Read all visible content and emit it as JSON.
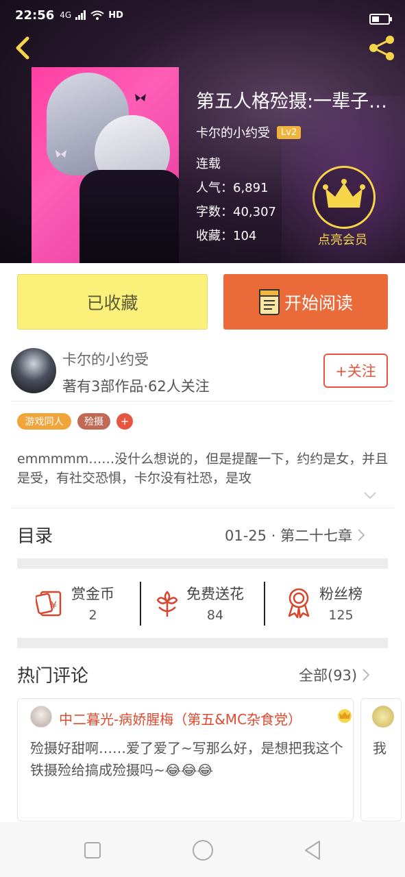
{
  "status_bar": {
    "time": "22:56",
    "network": "4G",
    "hd": "HD"
  },
  "book": {
    "title": "第五人格殓摄:一辈子…",
    "author": "卡尔的小约受",
    "level": "Lv2",
    "status": "连载",
    "popularity": "人气：6,891",
    "word_count": "字数：40,307",
    "favorites": "收藏：104",
    "vip_label": "点亮会员"
  },
  "actions": {
    "collect_label": "已收藏",
    "read_label": "开始阅读"
  },
  "author_row": {
    "name": "卡尔的小约受",
    "stats": "著有3部作品·62人关注",
    "follow_label": "+关注"
  },
  "tags": [
    {
      "label": "游戏同人",
      "color": "#f0a53a"
    },
    {
      "label": "殓摄",
      "color": "#c06a56"
    },
    {
      "label": "+",
      "color": "#e4563f"
    }
  ],
  "description": "emmmmm……没什么想说的，但是提醒一下，约约是女，并且是受，有社交恐惧，卡尔没有社恐，是攻",
  "catalog": {
    "title": "目录",
    "latest": "01-25 · 第二十七章"
  },
  "rewards": [
    {
      "label": "赏金币",
      "value": "2",
      "icon": "red-envelope-icon"
    },
    {
      "label": "免费送花",
      "value": "84",
      "icon": "flower-icon"
    },
    {
      "label": "粉丝榜",
      "value": "125",
      "icon": "medal-icon"
    }
  ],
  "comments": {
    "title": "热门评论",
    "all_label": "全部(93)",
    "items": [
      {
        "user": "中二暮光-病娇腥梅（第五&MC杂食党）",
        "text": "殓摄好甜啊……爱了爱了~写那么好，是想把我这个铁摄殓给搞成殓摄吗~😂😂😂"
      },
      {
        "user": "",
        "text": "我"
      }
    ]
  },
  "colors": {
    "accent_red": "#e4563f",
    "collect_yellow": "#fbf17a",
    "read_orange": "#ea6a3a",
    "crown_gold": "#f7d54a"
  }
}
